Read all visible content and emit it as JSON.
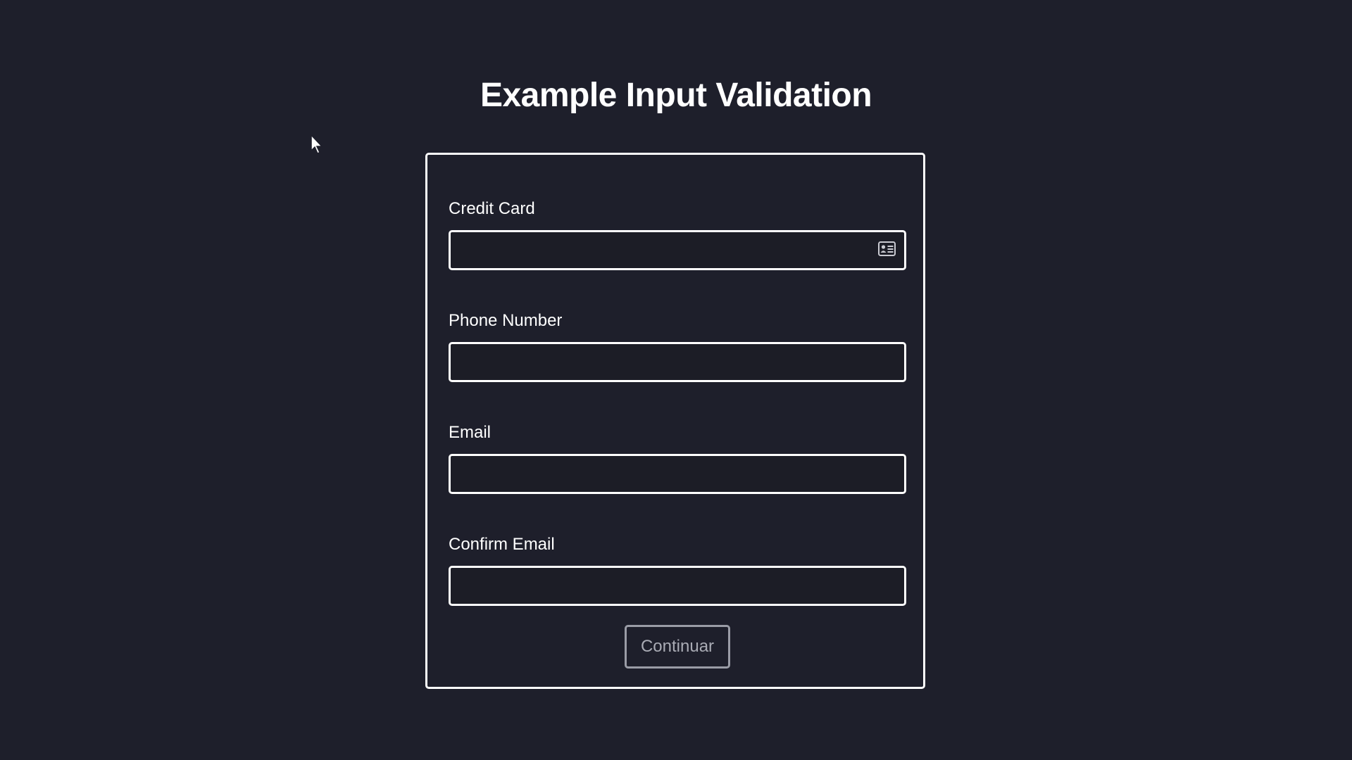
{
  "page": {
    "title": "Example Input Validation"
  },
  "form": {
    "fields": [
      {
        "label": "Credit Card",
        "value": "",
        "icon": "id-card-icon"
      },
      {
        "label": "Phone Number",
        "value": ""
      },
      {
        "label": "Email",
        "value": ""
      },
      {
        "label": "Confirm Email",
        "value": ""
      }
    ],
    "submit_label": "Continuar"
  },
  "colors": {
    "background": "#1e1f2b",
    "foreground": "#ffffff",
    "button_muted": "#9a9ca6"
  }
}
